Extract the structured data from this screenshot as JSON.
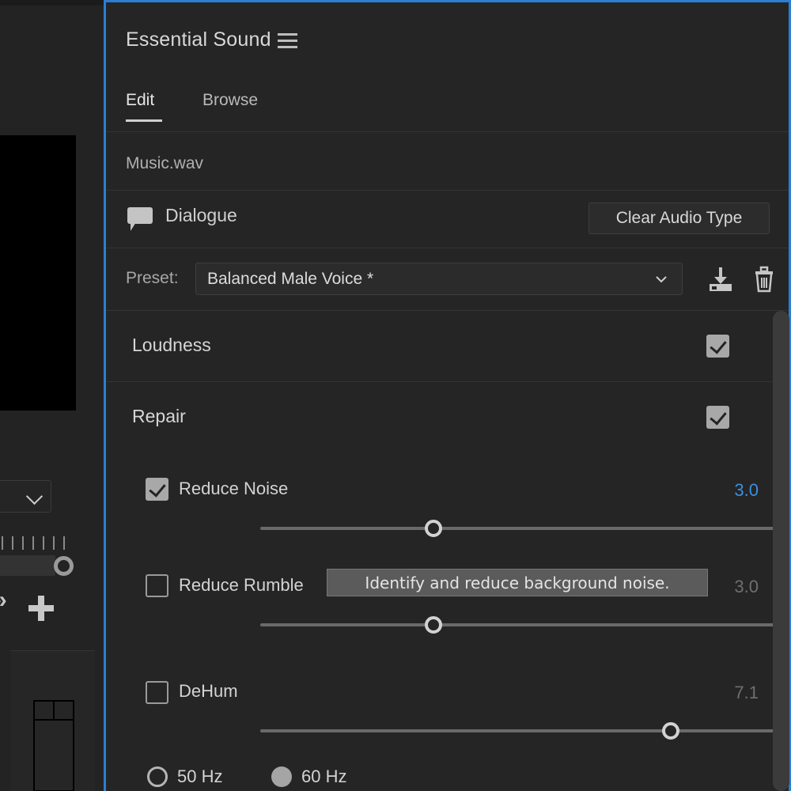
{
  "panel": {
    "title": "Essential Sound",
    "menu_icon": "hamburger-menu-icon",
    "tabs": [
      {
        "label": "Edit",
        "active": true
      },
      {
        "label": "Browse",
        "active": false
      }
    ],
    "filename": "Music.wav",
    "audio_type": {
      "icon": "dialogue-speech-bubble-icon",
      "label": "Dialogue",
      "clear_button_label": "Clear Audio Type"
    },
    "preset": {
      "label": "Preset:",
      "value": "Balanced Male Voice *",
      "dropdown_icon": "chevron-down-icon",
      "save_icon": "save-preset-icon",
      "delete_icon": "trash-icon"
    },
    "sections": [
      {
        "title": "Loudness",
        "checked": true
      },
      {
        "title": "Repair",
        "checked": true
      }
    ],
    "repair_params": [
      {
        "name": "Reduce Noise",
        "checked": true,
        "value": "3.0",
        "value_active": true,
        "slider_percent": 30
      },
      {
        "name": "Reduce Rumble",
        "checked": false,
        "value": "3.0",
        "value_active": false,
        "slider_percent": 30
      },
      {
        "name": "DeHum",
        "checked": false,
        "value": "7.1",
        "value_active": false,
        "slider_percent": 71
      }
    ],
    "dehum_frequency": {
      "options": [
        {
          "label": "50 Hz",
          "selected": false
        },
        {
          "label": "60 Hz",
          "selected": true
        }
      ]
    },
    "tooltip": "Identify and reduce background noise."
  },
  "left_panel": {
    "dropdown_icon": "chevron-down-icon",
    "expand_icon": "double-chevron-right-icon",
    "add_icon": "plus-icon"
  },
  "colors": {
    "accent_blue": "#2a7fd4",
    "value_blue": "#3b8fe3",
    "panel_bg": "#252525",
    "app_bg": "#232323"
  }
}
